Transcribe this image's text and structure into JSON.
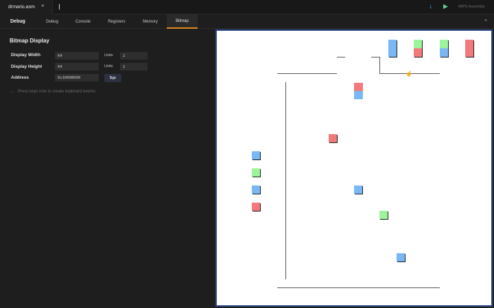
{
  "file_tab": {
    "name": "drmario.asm",
    "close": "×"
  },
  "toolbar": {
    "download_icon": "arrow-down-icon",
    "run_icon": "play-icon",
    "language": "MIPS Assembly"
  },
  "nav": {
    "title": "Debug",
    "tabs": [
      {
        "label": "Debug",
        "active": false
      },
      {
        "label": "Console",
        "active": false
      },
      {
        "label": "Registers",
        "active": false
      },
      {
        "label": "Memory",
        "active": false
      },
      {
        "label": "Bitmap",
        "active": true
      }
    ],
    "close": "×",
    "accent": "#e08a1e"
  },
  "bitmap_settings": {
    "title": "Bitmap Display",
    "display_width": {
      "label": "Display Width",
      "value": "64",
      "units_label": "Units",
      "units_value": "2"
    },
    "display_height": {
      "label": "Display Height",
      "value": "64",
      "units_label": "Units",
      "units_value": "2"
    },
    "address": {
      "label": "Address",
      "value": "0x10008000",
      "button": "$gp"
    },
    "hint_arrow": "→",
    "hint": "Press keys now to create keyboard events."
  },
  "bitmap": {
    "background": "#ffffff",
    "colors": {
      "blue": "#7ab8f5",
      "green": "#9cf59c",
      "red": "#f27a7a",
      "outline": "#1a1a1a"
    }
  }
}
